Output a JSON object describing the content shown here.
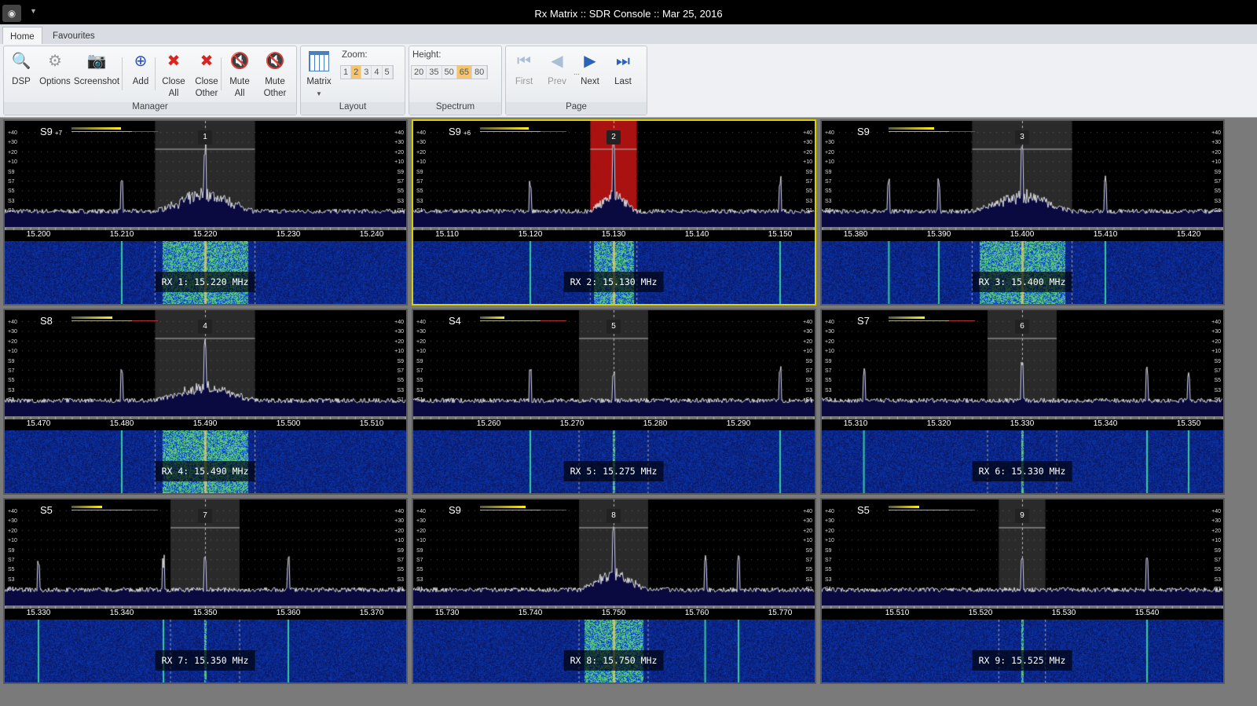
{
  "window": {
    "title": "Rx Matrix :: SDR Console :: Mar 25, 2016",
    "app_icon": "camera-icon"
  },
  "tabs": [
    {
      "label": "Home",
      "active": true
    },
    {
      "label": "Favourites",
      "active": false
    }
  ],
  "ribbon": {
    "manager": {
      "label": "Manager",
      "buttons": [
        {
          "id": "dsp",
          "l1": "DSP",
          "l2": "",
          "icon": "dsp-icon"
        },
        {
          "id": "options",
          "l1": "Options",
          "l2": "",
          "icon": "gear-icon"
        },
        {
          "id": "screenshot",
          "l1": "Screenshot",
          "l2": "",
          "icon": "camera-icon"
        },
        {
          "id": "add",
          "l1": "Add",
          "l2": "",
          "icon": "plus-circle-icon"
        },
        {
          "id": "close-all",
          "l1": "Close",
          "l2": "All",
          "icon": "close-window-icon"
        },
        {
          "id": "close-other",
          "l1": "Close",
          "l2": "Other",
          "icon": "close-window-icon"
        },
        {
          "id": "mute-all",
          "l1": "Mute",
          "l2": "All",
          "icon": "mute-speaker-icon"
        },
        {
          "id": "mute-other",
          "l1": "Mute",
          "l2": "Other",
          "icon": "mute-speaker-icon"
        }
      ]
    },
    "layout": {
      "label": "Layout",
      "matrix_label": "Matrix",
      "zoom_label": "Zoom:",
      "zoom_options": [
        "1",
        "2",
        "3",
        "4",
        "5"
      ],
      "zoom_selected": "2"
    },
    "spectrum": {
      "label": "Spectrum",
      "height_label": "Height:",
      "height_options": [
        "20",
        "35",
        "50",
        "65",
        "80"
      ],
      "height_selected": "65"
    },
    "page": {
      "label": "Page",
      "ellipsis": "...",
      "buttons": [
        {
          "l": "First",
          "enabled": false
        },
        {
          "l": "Prev",
          "enabled": false
        },
        {
          "l": "Next",
          "enabled": true
        },
        {
          "l": "Last",
          "enabled": true
        }
      ]
    }
  },
  "scale_labels": [
    "+40",
    "+30",
    "+20",
    "+10",
    "S9",
    "S7",
    "S5",
    "S3",
    "S1"
  ],
  "colors": {
    "selected_border": "#d8d000",
    "passband_selected": "#c01010"
  },
  "receivers": [
    {
      "n": "1",
      "smeter": "S9",
      "plus": "+7",
      "level": 0.82,
      "freq": 15.22,
      "bw": 12,
      "ticks": [
        "15.200",
        "15.210",
        "15.220",
        "15.230",
        "15.240"
      ],
      "label": "RX 1: 15.220 MHz",
      "signals": [
        15.21
      ],
      "selected": false
    },
    {
      "n": "2",
      "smeter": "S9",
      "plus": "+6",
      "level": 0.8,
      "freq": 15.13,
      "bw": 5.6,
      "ticks": [
        "15.110",
        "15.120",
        "15.130",
        "15.140",
        "15.150"
      ],
      "label": "RX 2: 15.130 MHz",
      "signals": [
        15.12,
        15.15
      ],
      "selected": true
    },
    {
      "n": "3",
      "smeter": "S9",
      "plus": "",
      "level": 0.75,
      "freq": 15.4,
      "bw": 12,
      "ticks": [
        "15.380",
        "15.390",
        "15.400",
        "15.410",
        "15.420"
      ],
      "label": "RX 3: 15.400 MHz",
      "signals": [
        15.384,
        15.39,
        15.41
      ],
      "selected": false
    },
    {
      "n": "4",
      "smeter": "S8",
      "plus": "",
      "level": 0.68,
      "freq": 15.49,
      "bw": 12,
      "ticks": [
        "15.470",
        "15.480",
        "15.490",
        "15.500",
        "15.510"
      ],
      "label": "RX 4: 15.490 MHz",
      "signals": [
        15.48
      ],
      "selected": false
    },
    {
      "n": "5",
      "smeter": "S4",
      "plus": "",
      "level": 0.4,
      "freq": 15.275,
      "bw": 8.3,
      "ticks": [
        "15.260",
        "15.270",
        "15.280",
        "15.290"
      ],
      "label": "RX 5: 15.275 MHz",
      "signals": [
        15.265,
        15.295
      ],
      "selected": false
    },
    {
      "n": "6",
      "smeter": "S7",
      "plus": "",
      "level": 0.6,
      "freq": 15.33,
      "bw": 8.3,
      "ticks": [
        "15.310",
        "15.320",
        "15.330",
        "15.340",
        "15.350"
      ],
      "label": "RX 6: 15.330 MHz",
      "signals": [
        15.311,
        15.345,
        15.35
      ],
      "selected": false
    },
    {
      "n": "7",
      "smeter": "S5",
      "plus": "",
      "level": 0.5,
      "freq": 15.35,
      "bw": 8.3,
      "ticks": [
        "15.330",
        "15.340",
        "15.350",
        "15.360",
        "15.370"
      ],
      "label": "RX 7: 15.350 MHz",
      "signals": [
        15.33,
        15.345,
        15.36
      ],
      "selected": false
    },
    {
      "n": "8",
      "smeter": "S9",
      "plus": "",
      "level": 0.75,
      "freq": 15.75,
      "bw": 8.3,
      "ticks": [
        "15.730",
        "15.740",
        "15.750",
        "15.760",
        "15.770"
      ],
      "label": "RX 8: 15.750 MHz",
      "signals": [
        15.761,
        15.765
      ],
      "selected": false
    },
    {
      "n": "9",
      "smeter": "S5",
      "plus": "",
      "level": 0.5,
      "freq": 15.525,
      "bw": 5.6,
      "ticks": [
        "15.510",
        "15.520",
        "15.530",
        "15.540"
      ],
      "label": "RX 9: 15.525 MHz",
      "signals": [
        15.54
      ],
      "selected": false
    }
  ]
}
